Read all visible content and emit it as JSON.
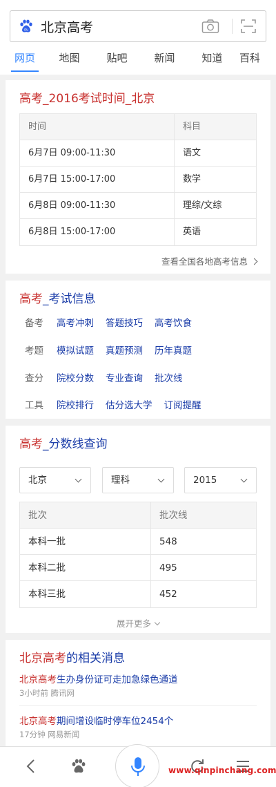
{
  "search": {
    "query": "北京高考"
  },
  "tabs": [
    {
      "label": "网页",
      "active": true
    },
    {
      "label": "地图"
    },
    {
      "label": "贴吧"
    },
    {
      "label": "新闻"
    },
    {
      "label": "知道"
    },
    {
      "label": "百科"
    }
  ],
  "card_exam_time": {
    "title_red": "高考_2016考试时间_北京",
    "headers": [
      "时间",
      "科目"
    ],
    "rows": [
      [
        "6月7日 09:00-11:30",
        "语文"
      ],
      [
        "6月7日 15:00-17:00",
        "数学"
      ],
      [
        "6月8日 09:00-11:30",
        "理综/文综"
      ],
      [
        "6月8日 15:00-17:00",
        "英语"
      ]
    ],
    "more_link": "查看全国各地高考信息"
  },
  "card_exam_info": {
    "title_red": "高考",
    "title_blue": "_考试信息",
    "rows": [
      {
        "category": "备考",
        "links": [
          "高考冲刺",
          "答题技巧",
          "高考饮食"
        ]
      },
      {
        "category": "考题",
        "links": [
          "模拟试题",
          "真题预测",
          "历年真题"
        ]
      },
      {
        "category": "查分",
        "links": [
          "院校分数",
          "专业查询",
          "批次线"
        ]
      },
      {
        "category": "工具",
        "links": [
          "院校排行",
          "估分选大学",
          "订阅提醒"
        ]
      }
    ]
  },
  "card_score_line": {
    "title_red": "高考",
    "title_blue": "_分数线查询",
    "selects": {
      "region": "北京",
      "subject": "理科",
      "year": "2015"
    },
    "headers": [
      "批次",
      "批次线"
    ],
    "rows": [
      [
        "本科一批",
        "548"
      ],
      [
        "本科二批",
        "495"
      ],
      [
        "本科三批",
        "452"
      ]
    ],
    "expand_label": "展开更多"
  },
  "card_news": {
    "title_red": "北京高考",
    "title_blue": "的相关消息",
    "items": [
      {
        "title_red": "北京高考",
        "title_rest": "生办身份证可走加急绿色通道",
        "meta": "3小时前 腾讯网"
      },
      {
        "title_red": "北京高考",
        "title_rest": "期间增设临时停车位2454个",
        "meta": "17分钟 网易新闻"
      }
    ]
  },
  "bottom_bar": {
    "icons": [
      "back-icon",
      "baidu-paw-icon",
      "microphone-icon",
      "refresh-icon",
      "menu-icon"
    ]
  },
  "watermark": "www.qinpinchang.com",
  "colors": {
    "accent": "#3385ff",
    "title_red": "#c8312f",
    "link_blue": "#1a3ca8"
  }
}
